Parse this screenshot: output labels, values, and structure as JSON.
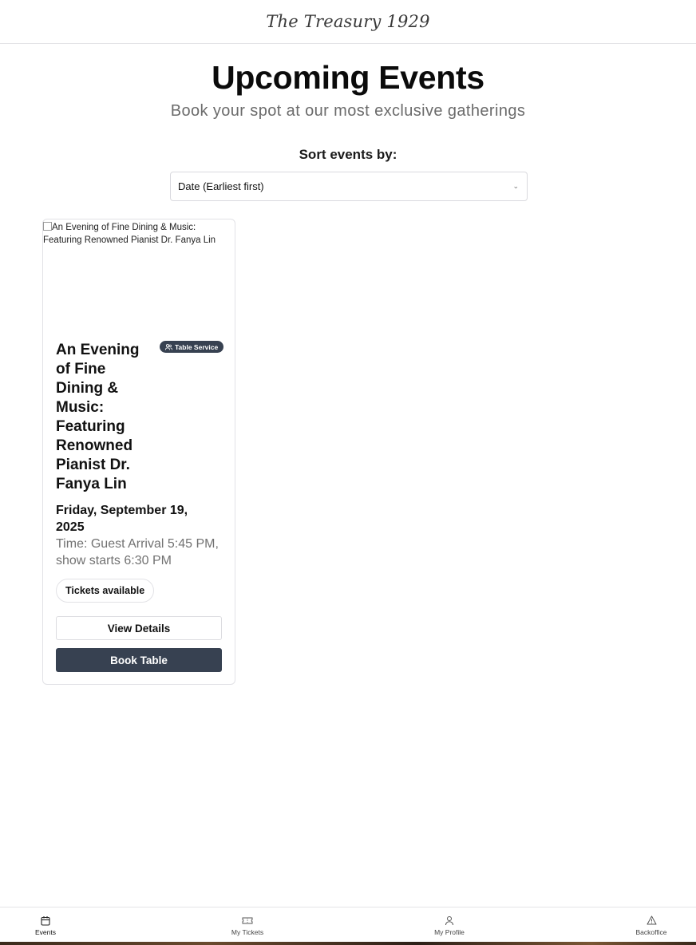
{
  "header": {
    "brand": "The Treasury 1929"
  },
  "page": {
    "title": "Upcoming Events",
    "subtitle": "Book your spot at our most exclusive gatherings"
  },
  "sort": {
    "label": "Sort events by:",
    "selected": "Date (Earliest first)"
  },
  "events": [
    {
      "image_alt": "An Evening of Fine Dining & Music: Featuring Renowned Pianist Dr. Fanya Lin",
      "badge": "Table Service",
      "title": "An Evening of Fine Dining & Music: Featuring Renowned Pianist Dr. Fanya Lin",
      "date": "Friday, September 19, 2025",
      "time": "Time: Guest Arrival 5:45 PM, show starts 6:30 PM",
      "availability": "Tickets available",
      "details_label": "View Details",
      "book_label": "Book Table"
    }
  ],
  "nav": {
    "items": [
      {
        "label": "Events",
        "icon": "calendar-icon",
        "active": true
      },
      {
        "label": "My Tickets",
        "icon": "ticket-icon",
        "active": false
      },
      {
        "label": "My Profile",
        "icon": "user-icon",
        "active": false
      },
      {
        "label": "Backoffice",
        "icon": "warning-icon",
        "active": false
      }
    ]
  },
  "colors": {
    "primary": "#374151",
    "muted_text": "#727272",
    "border": "#e2e2e6"
  }
}
